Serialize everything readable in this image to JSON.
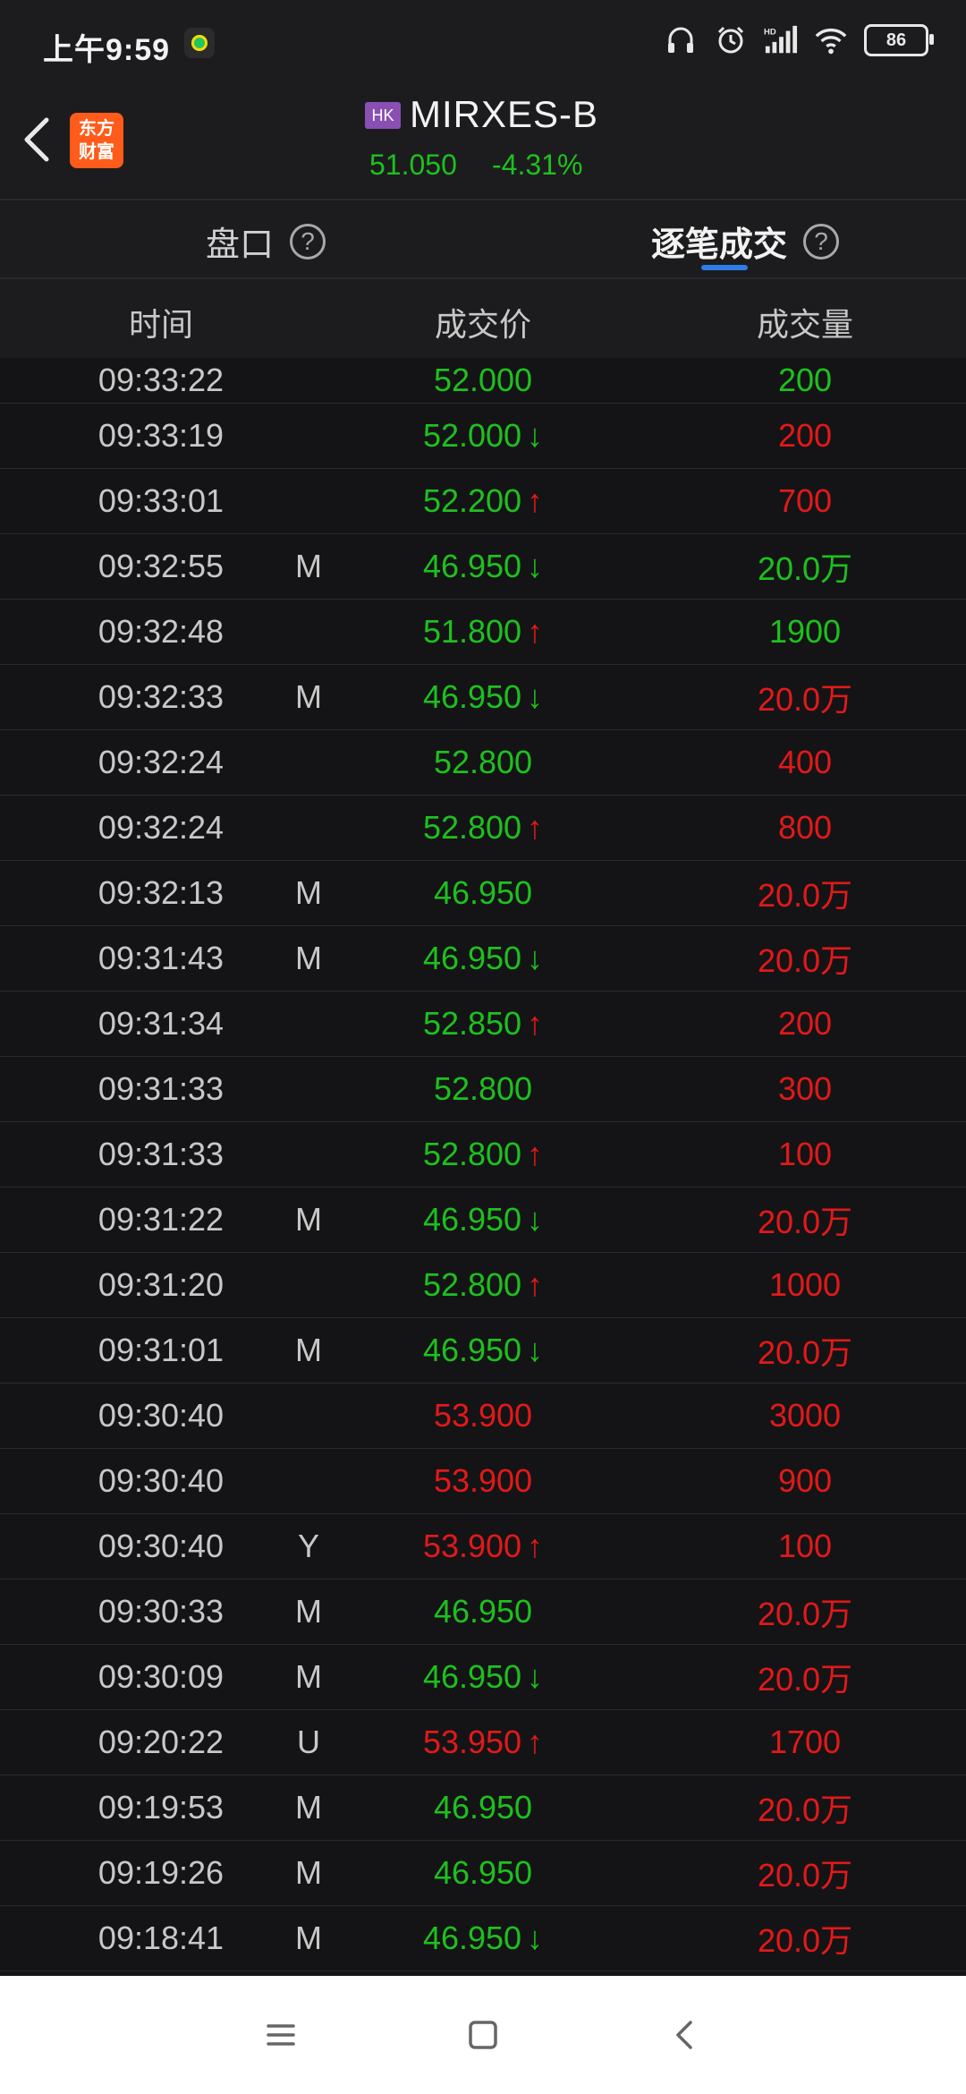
{
  "status_bar": {
    "time": "上午9:59",
    "battery": "86"
  },
  "header": {
    "logo_line1": "东方",
    "logo_line2": "财富",
    "market_badge": "HK",
    "title": "MIRXES-B",
    "price": "51.050",
    "change_pct": "-4.31%"
  },
  "tabs": [
    {
      "label": "盘口",
      "active": false
    },
    {
      "label": "逐笔成交",
      "active": true
    }
  ],
  "columns": [
    "时间",
    "成交价",
    "成交量"
  ],
  "colors": {
    "up": "#e21919",
    "down": "#1ec01e",
    "accent": "#2e7ce6",
    "background": "#151517"
  },
  "trades": [
    {
      "time": "09:33:22",
      "flag": "",
      "price": "52.000",
      "price_color": "green",
      "arrow": "",
      "volume": "200",
      "volume_color": "green"
    },
    {
      "time": "09:33:19",
      "flag": "",
      "price": "52.000",
      "price_color": "green",
      "arrow": "down",
      "volume": "200",
      "volume_color": "red"
    },
    {
      "time": "09:33:01",
      "flag": "",
      "price": "52.200",
      "price_color": "green",
      "arrow": "up",
      "volume": "700",
      "volume_color": "red"
    },
    {
      "time": "09:32:55",
      "flag": "M",
      "price": "46.950",
      "price_color": "green",
      "arrow": "down",
      "volume": "20.0万",
      "volume_color": "green"
    },
    {
      "time": "09:32:48",
      "flag": "",
      "price": "51.800",
      "price_color": "green",
      "arrow": "up",
      "volume": "1900",
      "volume_color": "green"
    },
    {
      "time": "09:32:33",
      "flag": "M",
      "price": "46.950",
      "price_color": "green",
      "arrow": "down",
      "volume": "20.0万",
      "volume_color": "red"
    },
    {
      "time": "09:32:24",
      "flag": "",
      "price": "52.800",
      "price_color": "green",
      "arrow": "",
      "volume": "400",
      "volume_color": "red"
    },
    {
      "time": "09:32:24",
      "flag": "",
      "price": "52.800",
      "price_color": "green",
      "arrow": "up",
      "volume": "800",
      "volume_color": "red"
    },
    {
      "time": "09:32:13",
      "flag": "M",
      "price": "46.950",
      "price_color": "green",
      "arrow": "",
      "volume": "20.0万",
      "volume_color": "red"
    },
    {
      "time": "09:31:43",
      "flag": "M",
      "price": "46.950",
      "price_color": "green",
      "arrow": "down",
      "volume": "20.0万",
      "volume_color": "red"
    },
    {
      "time": "09:31:34",
      "flag": "",
      "price": "52.850",
      "price_color": "green",
      "arrow": "up",
      "volume": "200",
      "volume_color": "red"
    },
    {
      "time": "09:31:33",
      "flag": "",
      "price": "52.800",
      "price_color": "green",
      "arrow": "",
      "volume": "300",
      "volume_color": "red"
    },
    {
      "time": "09:31:33",
      "flag": "",
      "price": "52.800",
      "price_color": "green",
      "arrow": "up",
      "volume": "100",
      "volume_color": "red"
    },
    {
      "time": "09:31:22",
      "flag": "M",
      "price": "46.950",
      "price_color": "green",
      "arrow": "down",
      "volume": "20.0万",
      "volume_color": "red"
    },
    {
      "time": "09:31:20",
      "flag": "",
      "price": "52.800",
      "price_color": "green",
      "arrow": "up",
      "volume": "1000",
      "volume_color": "red"
    },
    {
      "time": "09:31:01",
      "flag": "M",
      "price": "46.950",
      "price_color": "green",
      "arrow": "down",
      "volume": "20.0万",
      "volume_color": "red"
    },
    {
      "time": "09:30:40",
      "flag": "",
      "price": "53.900",
      "price_color": "red",
      "arrow": "",
      "volume": "3000",
      "volume_color": "red"
    },
    {
      "time": "09:30:40",
      "flag": "",
      "price": "53.900",
      "price_color": "red",
      "arrow": "",
      "volume": "900",
      "volume_color": "red"
    },
    {
      "time": "09:30:40",
      "flag": "Y",
      "price": "53.900",
      "price_color": "red",
      "arrow": "up",
      "volume": "100",
      "volume_color": "red"
    },
    {
      "time": "09:30:33",
      "flag": "M",
      "price": "46.950",
      "price_color": "green",
      "arrow": "",
      "volume": "20.0万",
      "volume_color": "red"
    },
    {
      "time": "09:30:09",
      "flag": "M",
      "price": "46.950",
      "price_color": "green",
      "arrow": "down",
      "volume": "20.0万",
      "volume_color": "red"
    },
    {
      "time": "09:20:22",
      "flag": "U",
      "price": "53.950",
      "price_color": "red",
      "arrow": "up",
      "volume": "1700",
      "volume_color": "red"
    },
    {
      "time": "09:19:53",
      "flag": "M",
      "price": "46.950",
      "price_color": "green",
      "arrow": "",
      "volume": "20.0万",
      "volume_color": "red"
    },
    {
      "time": "09:19:26",
      "flag": "M",
      "price": "46.950",
      "price_color": "green",
      "arrow": "",
      "volume": "20.0万",
      "volume_color": "red"
    },
    {
      "time": "09:18:41",
      "flag": "M",
      "price": "46.950",
      "price_color": "green",
      "arrow": "down",
      "volume": "20.0万",
      "volume_color": "red"
    }
  ],
  "nav_icons": [
    "menu-icon",
    "home-icon",
    "back-icon"
  ]
}
